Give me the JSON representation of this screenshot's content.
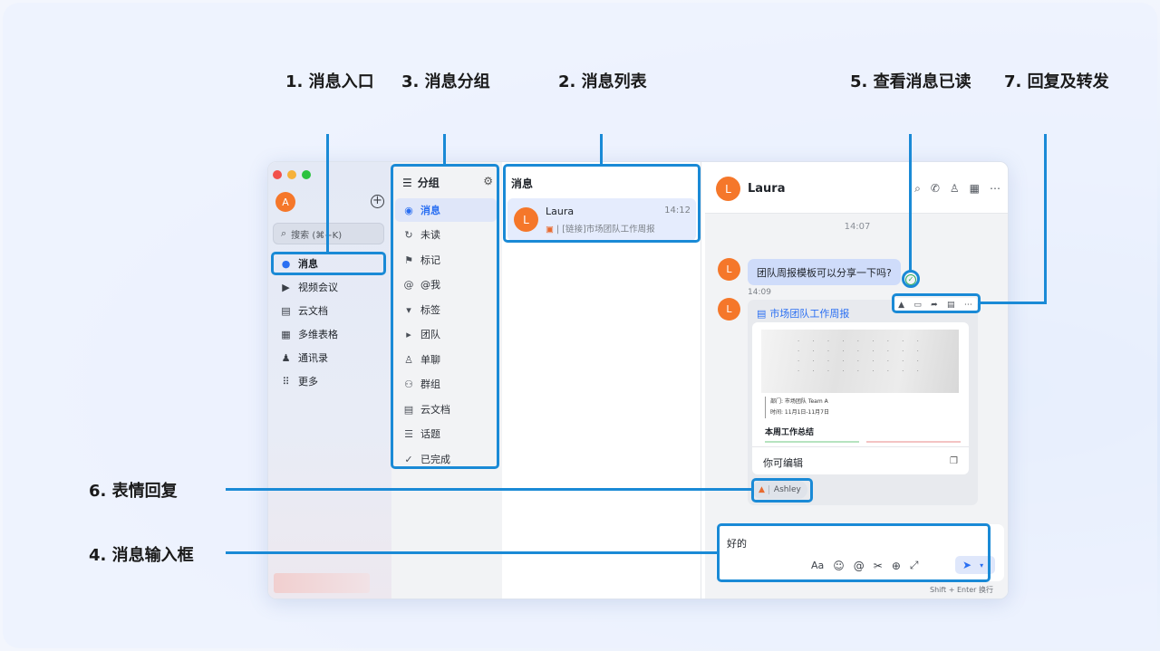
{
  "annotations": {
    "entry": "1. 消息入口",
    "groups": "3. 消息分组",
    "list": "2. 消息列表",
    "read": "5. 查看消息已读",
    "reply": "7. 回复及转发",
    "emoji": "6. 表情回复",
    "input": "4. 消息输入框"
  },
  "nav": {
    "avatar": "A",
    "search_placeholder": "搜索 (⌘+K)",
    "items": [
      {
        "label": "消息",
        "icon": "chat-bubble-icon",
        "glyph": "●"
      },
      {
        "label": "视频会议",
        "icon": "video-icon",
        "glyph": "▶"
      },
      {
        "label": "云文档",
        "icon": "doc-icon",
        "glyph": "▤"
      },
      {
        "label": "多维表格",
        "icon": "table-icon",
        "glyph": "▦"
      },
      {
        "label": "通讯录",
        "icon": "contacts-icon",
        "glyph": "♟"
      },
      {
        "label": "更多",
        "icon": "grid-icon",
        "glyph": "⠿"
      }
    ]
  },
  "groups": {
    "title": "分组",
    "items": [
      {
        "label": "消息",
        "icon": "message-icon",
        "glyph": "◉"
      },
      {
        "label": "未读",
        "icon": "refresh-icon",
        "glyph": "↻"
      },
      {
        "label": "标记",
        "icon": "flag-icon",
        "glyph": "⚑"
      },
      {
        "label": "@我",
        "icon": "at-icon",
        "glyph": "@"
      },
      {
        "label": "标签",
        "icon": "caret-down-icon",
        "glyph": "▾"
      },
      {
        "label": "团队",
        "icon": "caret-right-icon",
        "glyph": "▸"
      },
      {
        "label": "单聊",
        "icon": "person-icon",
        "glyph": "♙"
      },
      {
        "label": "群组",
        "icon": "group-icon",
        "glyph": "⚇"
      },
      {
        "label": "云文档",
        "icon": "doc-icon",
        "glyph": "▤"
      },
      {
        "label": "话题",
        "icon": "topic-icon",
        "glyph": "☰"
      },
      {
        "label": "已完成",
        "icon": "check-circle-icon",
        "glyph": "✓"
      }
    ]
  },
  "list": {
    "title": "消息",
    "conversation": {
      "avatar": "L",
      "name": "Laura",
      "time": "14:12",
      "preview": "[链接]市场团队工作周报"
    }
  },
  "chat": {
    "contact_avatar": "L",
    "contact_name": "Laura",
    "time_divider": "14:07",
    "message1": "团队周报模板可以分享一下吗?",
    "message1_time": "14:09",
    "card": {
      "title": "市场团队工作周报",
      "meta_line1": "部门: 市场团队 Team A",
      "meta_line2": "时间: 11月1日-11月7日",
      "section": "本周工作总结",
      "editable": "你可编辑"
    },
    "reaction_user": "Ashley",
    "input_text": "好的",
    "send_hint": "Shift + Enter 换行"
  },
  "colors": {
    "accent": "#2a6ff2",
    "annotation": "#1a8ad6",
    "avatar": "#f5772a",
    "bubble": "#cfdcfa",
    "read_check": "#2fae5f"
  }
}
